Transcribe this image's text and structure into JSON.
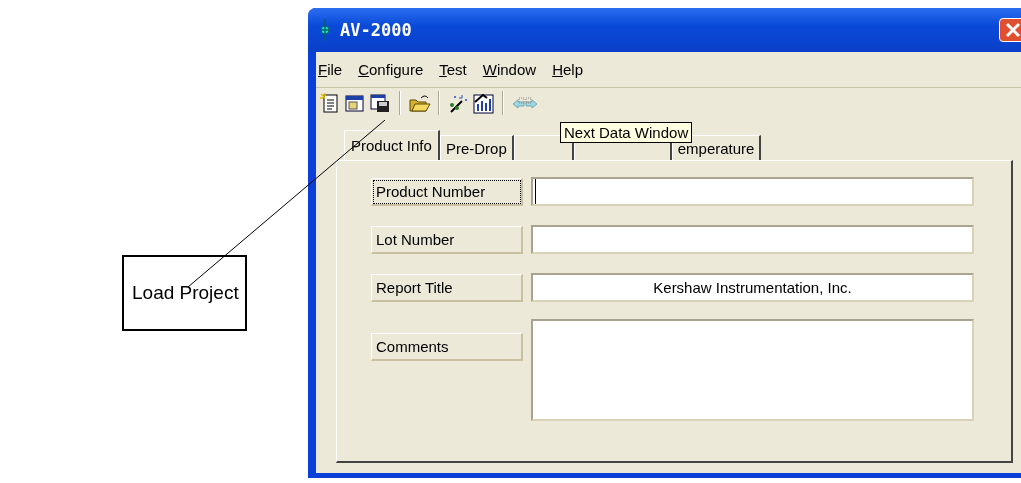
{
  "callout": {
    "text": "Load Project"
  },
  "window": {
    "title": "AV-2000"
  },
  "menu": [
    {
      "label": "File"
    },
    {
      "label": "Configure"
    },
    {
      "label": "Test"
    },
    {
      "label": "Window"
    },
    {
      "label": "Help"
    }
  ],
  "toolbar": [
    [
      {
        "kind": "new-document"
      },
      {
        "kind": "load-window"
      },
      {
        "kind": "save"
      }
    ],
    [
      {
        "kind": "open-folder"
      }
    ],
    [
      {
        "kind": "wand"
      },
      {
        "kind": "chart"
      }
    ],
    [
      {
        "kind": "arrows"
      }
    ]
  ],
  "tooltip": "Next Data Window",
  "tabs": [
    {
      "label": "Product Info",
      "selected": true
    },
    {
      "label": "Pre-Drop",
      "selected": false
    },
    {
      "selected": false
    },
    {
      "selected": false
    },
    {
      "label": "emperature",
      "selected": false
    }
  ],
  "fields": [
    {
      "label": "Product Number",
      "focused": true,
      "kind": "line"
    },
    {
      "label": "Lot Number",
      "focused": false,
      "kind": "line"
    },
    {
      "label": "Report Title",
      "value": "Kershaw Instrumentation, Inc.",
      "focused": false,
      "kind": "line"
    },
    {
      "label": "Comments",
      "focused": false,
      "kind": "multiline"
    }
  ]
}
